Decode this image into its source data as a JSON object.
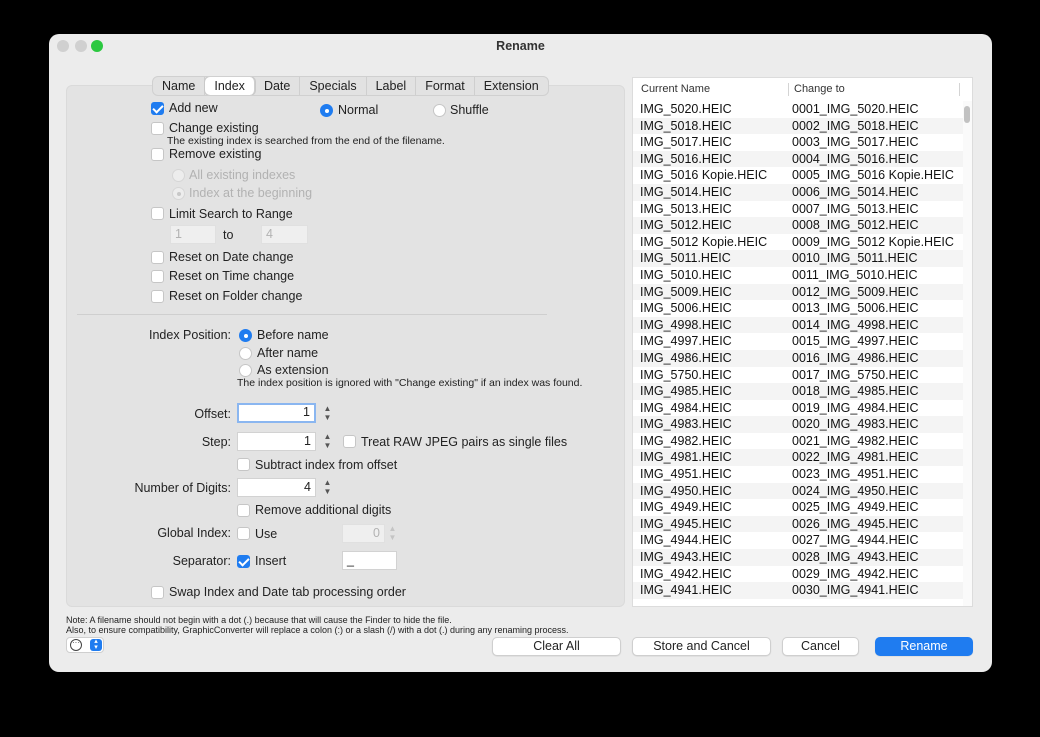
{
  "window": {
    "title": "Rename"
  },
  "tabs": [
    "Name",
    "Index",
    "Date",
    "Specials",
    "Label",
    "Format",
    "Extension"
  ],
  "options": {
    "add_new": "Add new",
    "normal": "Normal",
    "shuffle": "Shuffle",
    "change_existing": "Change existing",
    "change_existing_note": "The existing index is searched from the end of the filename.",
    "remove_existing": "Remove existing",
    "all_existing_indexes": "All existing indexes",
    "index_at_beginning": "Index at the beginning",
    "limit_search": "Limit Search to Range",
    "range_from": "1",
    "range_to_label": "to",
    "range_to": "4",
    "reset_date": "Reset on Date change",
    "reset_time": "Reset on Time change",
    "reset_folder": "Reset on Folder change"
  },
  "position": {
    "label": "Index Position:",
    "before_name": "Before name",
    "after_name": "After name",
    "as_extension": "As extension",
    "note": "The index position is ignored with \"Change existing\" if an index was found."
  },
  "numbers": {
    "offset_label": "Offset:",
    "offset_value": "1",
    "step_label": "Step:",
    "step_value": "1",
    "treat_raw": "Treat RAW JPEG pairs as single files",
    "subtract_index": "Subtract index from offset",
    "digits_label": "Number of Digits:",
    "digits_value": "4",
    "remove_digits": "Remove additional digits",
    "global_label": "Global Index:",
    "global_use": "Use",
    "global_value": "0",
    "separator_label": "Separator:",
    "separator_insert": "Insert",
    "separator_value": "_",
    "swap_order": "Swap Index and Date tab processing order"
  },
  "notes": {
    "line1": "Note: A filename should not begin with a dot (.) because that will cause the Finder to hide the file.",
    "line2": "Also, to ensure compatibility, GraphicConverter will replace a colon (:) or a slash (/) with a dot (.) during any renaming process."
  },
  "list": {
    "header_current": "Current Name",
    "header_change": "Change to",
    "rows": [
      [
        "IMG_5020.HEIC",
        "0001_IMG_5020.HEIC"
      ],
      [
        "IMG_5018.HEIC",
        "0002_IMG_5018.HEIC"
      ],
      [
        "IMG_5017.HEIC",
        "0003_IMG_5017.HEIC"
      ],
      [
        "IMG_5016.HEIC",
        "0004_IMG_5016.HEIC"
      ],
      [
        "IMG_5016 Kopie.HEIC",
        "0005_IMG_5016 Kopie.HEIC"
      ],
      [
        "IMG_5014.HEIC",
        "0006_IMG_5014.HEIC"
      ],
      [
        "IMG_5013.HEIC",
        "0007_IMG_5013.HEIC"
      ],
      [
        "IMG_5012.HEIC",
        "0008_IMG_5012.HEIC"
      ],
      [
        "IMG_5012 Kopie.HEIC",
        "0009_IMG_5012 Kopie.HEIC"
      ],
      [
        "IMG_5011.HEIC",
        "0010_IMG_5011.HEIC"
      ],
      [
        "IMG_5010.HEIC",
        "0011_IMG_5010.HEIC"
      ],
      [
        "IMG_5009.HEIC",
        "0012_IMG_5009.HEIC"
      ],
      [
        "IMG_5006.HEIC",
        "0013_IMG_5006.HEIC"
      ],
      [
        "IMG_4998.HEIC",
        "0014_IMG_4998.HEIC"
      ],
      [
        "IMG_4997.HEIC",
        "0015_IMG_4997.HEIC"
      ],
      [
        "IMG_4986.HEIC",
        "0016_IMG_4986.HEIC"
      ],
      [
        "IMG_5750.HEIC",
        "0017_IMG_5750.HEIC"
      ],
      [
        "IMG_4985.HEIC",
        "0018_IMG_4985.HEIC"
      ],
      [
        "IMG_4984.HEIC",
        "0019_IMG_4984.HEIC"
      ],
      [
        "IMG_4983.HEIC",
        "0020_IMG_4983.HEIC"
      ],
      [
        "IMG_4982.HEIC",
        "0021_IMG_4982.HEIC"
      ],
      [
        "IMG_4981.HEIC",
        "0022_IMG_4981.HEIC"
      ],
      [
        "IMG_4951.HEIC",
        "0023_IMG_4951.HEIC"
      ],
      [
        "IMG_4950.HEIC",
        "0024_IMG_4950.HEIC"
      ],
      [
        "IMG_4949.HEIC",
        "0025_IMG_4949.HEIC"
      ],
      [
        "IMG_4945.HEIC",
        "0026_IMG_4945.HEIC"
      ],
      [
        "IMG_4944.HEIC",
        "0027_IMG_4944.HEIC"
      ],
      [
        "IMG_4943.HEIC",
        "0028_IMG_4943.HEIC"
      ],
      [
        "IMG_4942.HEIC",
        "0029_IMG_4942.HEIC"
      ],
      [
        "IMG_4941.HEIC",
        "0030_IMG_4941.HEIC"
      ]
    ]
  },
  "buttons": {
    "clear_all": "Clear All",
    "store_cancel": "Store and Cancel",
    "cancel": "Cancel",
    "rename": "Rename"
  },
  "colors": {
    "accent": "#1f7cf0",
    "window_bg": "#ececec",
    "green_light": "#2bc840"
  }
}
